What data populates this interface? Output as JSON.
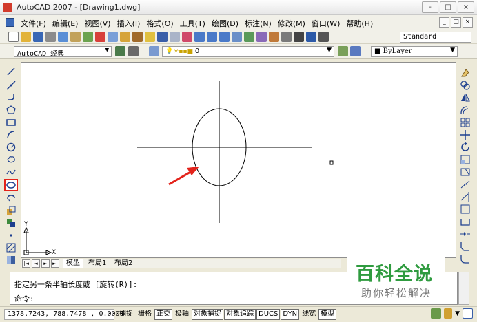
{
  "window": {
    "title": "AutoCAD 2007 - [Drawing1.dwg]",
    "controls": [
      "-",
      "□",
      "×"
    ]
  },
  "menubar": {
    "items": [
      "文件(F)",
      "编辑(E)",
      "视图(V)",
      "插入(I)",
      "格式(O)",
      "工具(T)",
      "绘图(D)",
      "标注(N)",
      "修改(M)",
      "窗口(W)",
      "帮助(H)"
    ],
    "doc_controls": [
      "_",
      "□",
      "×"
    ]
  },
  "toolbar": {
    "text_style": "Standard"
  },
  "properties_bar": {
    "workspace": "AutoCAD 经典",
    "layer": "0",
    "color": "ByLayer"
  },
  "layout_tabs": {
    "nav": [
      "|◄",
      "◄",
      "►",
      "►|"
    ],
    "tabs": [
      "模型",
      "布局1",
      "布局2"
    ],
    "active": "模型"
  },
  "command_line": {
    "prompt_line": "指定另一条半轴长度或 [旋转(R)]:",
    "input_line": "命令:"
  },
  "status_bar": {
    "coordinates": "1378.7243, 788.7478 , 0.0000",
    "toggles": [
      {
        "label": "捕捉",
        "on": false
      },
      {
        "label": "栅格",
        "on": false
      },
      {
        "label": "正交",
        "on": true
      },
      {
        "label": "极轴",
        "on": false
      },
      {
        "label": "对象捕捉",
        "on": true
      },
      {
        "label": "对象追踪",
        "on": true
      },
      {
        "label": "DUCS",
        "on": true
      },
      {
        "label": "DYN",
        "on": true
      },
      {
        "label": "线宽",
        "on": false
      },
      {
        "label": "模型",
        "on": true
      }
    ]
  },
  "ucs": {
    "x_label": "X",
    "y_label": "Y"
  },
  "watermark": {
    "title": "百科全说",
    "subtitle": "助你轻松解决"
  },
  "colors": {
    "annotation": "#e3231b",
    "watermark_green": "#2f9b3f"
  },
  "selected_tool": "ellipse-icon"
}
